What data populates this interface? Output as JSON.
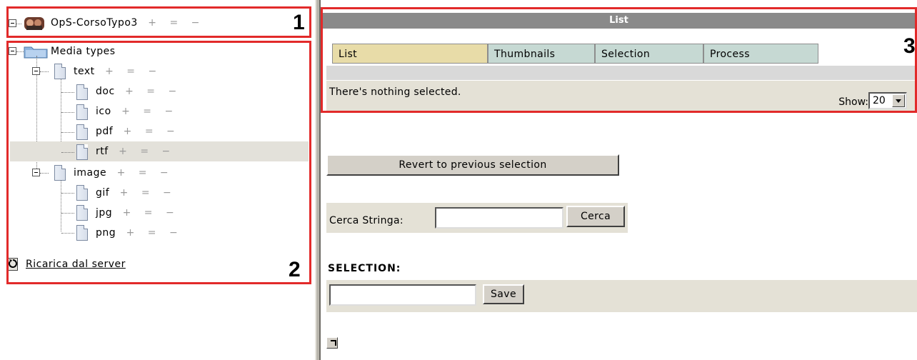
{
  "tree": {
    "root": {
      "label": "OpS-CorsoTypo3",
      "controls": "+ = −"
    },
    "media_types": {
      "label": "Media types"
    },
    "text": {
      "label": "text",
      "controls": "+ = −",
      "children": [
        {
          "label": "doc",
          "controls": "+ = −"
        },
        {
          "label": "ico",
          "controls": "+ = −"
        },
        {
          "label": "pdf",
          "controls": "+ = −"
        },
        {
          "label": "rtf",
          "controls": "+ = −"
        }
      ]
    },
    "image": {
      "label": "image",
      "controls": "+ = −",
      "children": [
        {
          "label": "gif",
          "controls": "+ = −"
        },
        {
          "label": "jpg",
          "controls": "+ = −"
        },
        {
          "label": "png",
          "controls": "+ = −"
        }
      ]
    },
    "reload_link": "Ricarica dal server"
  },
  "annotations": {
    "n1": "1",
    "n2": "2",
    "n3": "3",
    "color": "#e22a2a"
  },
  "main": {
    "title": "List",
    "tabs": [
      "List",
      "Thumbnails",
      "Selection",
      "Process"
    ],
    "active_tab_color": "#e8dca8",
    "tab_color": "#c6d9d3",
    "status_message": "There's nothing selected.",
    "show_label": "Show:",
    "show_value": "20",
    "revert_button": "Revert to previous selection",
    "search_label": "Cerca Stringa:",
    "search_value": "",
    "search_button": "Cerca",
    "selection_heading": "SELECTION:",
    "selection_value": "",
    "save_button": "Save"
  }
}
